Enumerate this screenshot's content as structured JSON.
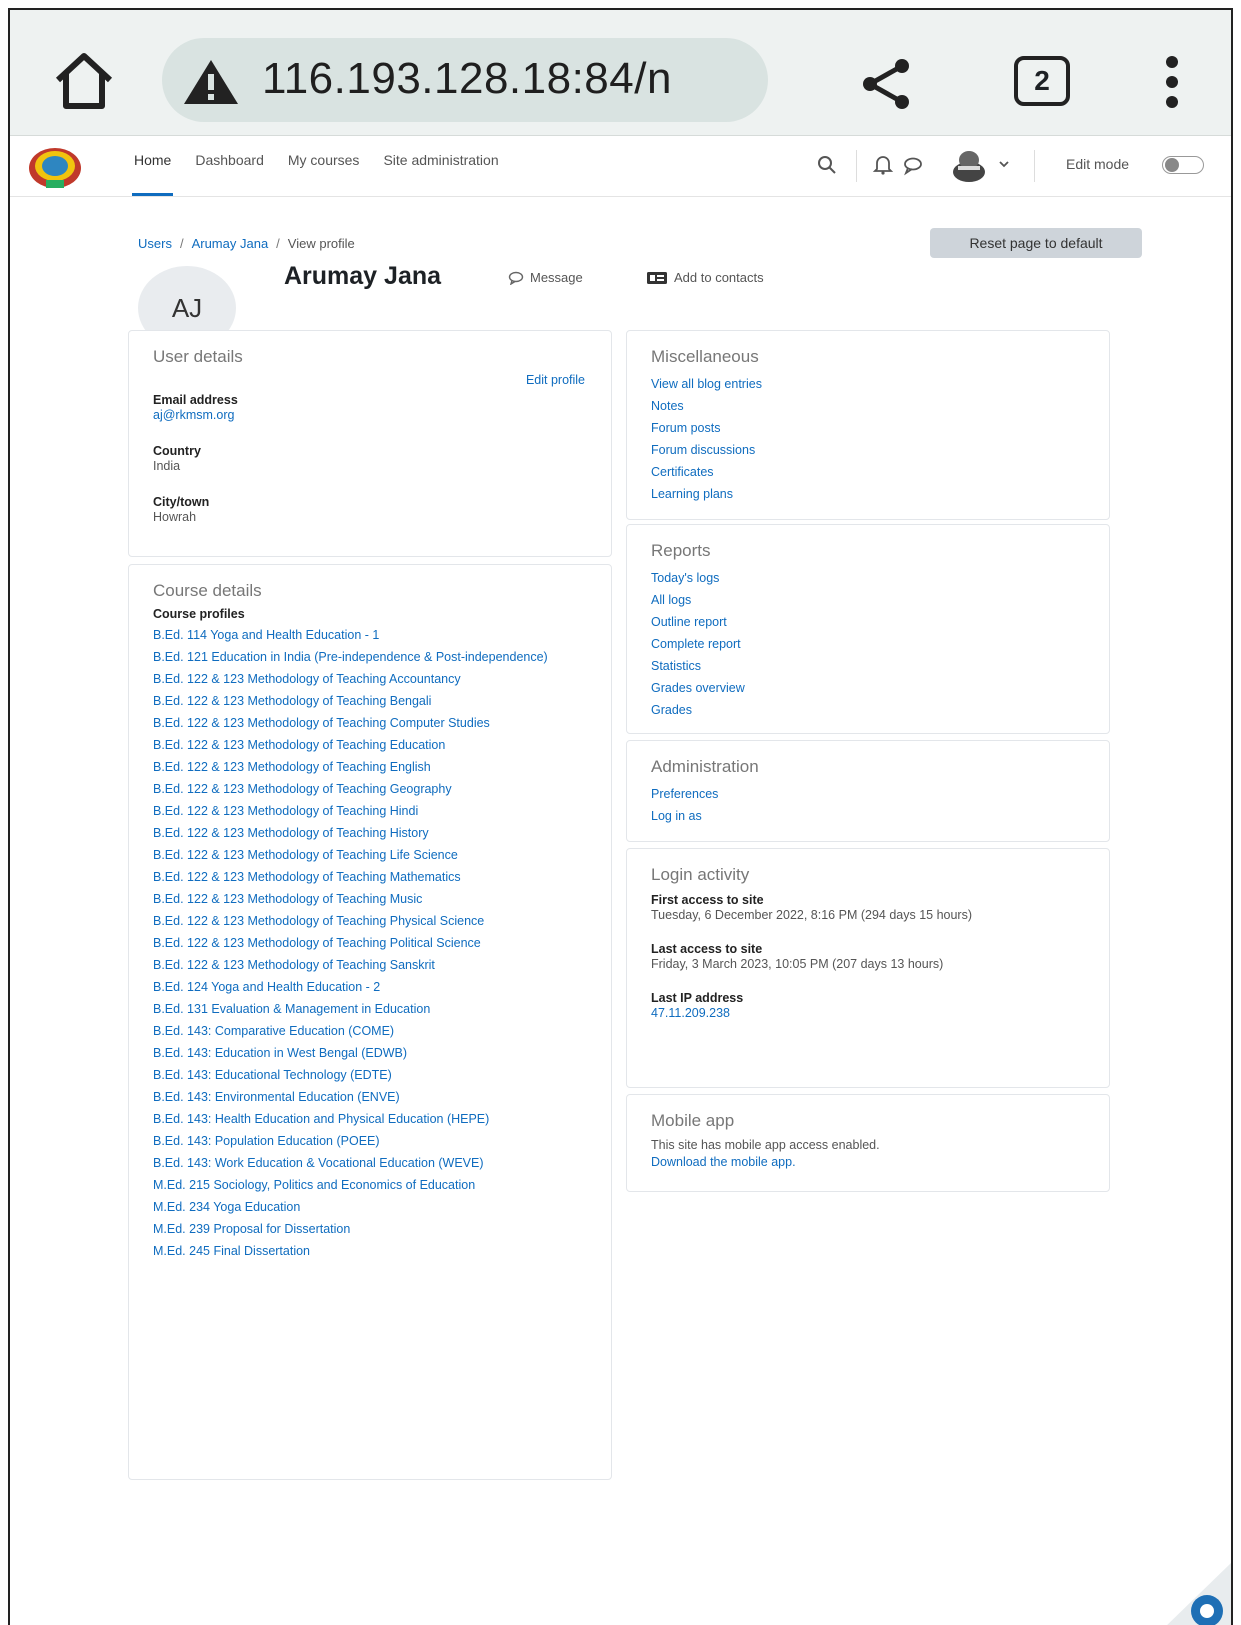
{
  "browser": {
    "url": "116.193.128.18:84/n",
    "tab_count": "2"
  },
  "nav": {
    "items": [
      {
        "label": "Home",
        "active": true
      },
      {
        "label": "Dashboard",
        "active": false
      },
      {
        "label": "My courses",
        "active": false
      },
      {
        "label": "Site administration",
        "active": false
      }
    ],
    "edit_mode_label": "Edit mode"
  },
  "breadcrumb": {
    "users": "Users",
    "user": "Arumay Jana",
    "current": "View profile",
    "sep": "/"
  },
  "header": {
    "reset_label": "Reset page to default",
    "initials": "AJ",
    "name": "Arumay Jana",
    "message_label": "Message",
    "contacts_label": "Add to contacts"
  },
  "user_details": {
    "title": "User details",
    "edit_label": "Edit profile",
    "email_label": "Email address",
    "email": "aj@rkmsm.org",
    "country_label": "Country",
    "country": "India",
    "city_label": "City/town",
    "city": "Howrah"
  },
  "course_details": {
    "title": "Course details",
    "profiles_label": "Course profiles",
    "courses": [
      "B.Ed. 114 Yoga and Health Education - 1",
      "B.Ed. 121 Education in India (Pre-independence & Post-independence)",
      "B.Ed. 122 & 123 Methodology of Teaching Accountancy",
      "B.Ed. 122 & 123 Methodology of Teaching Bengali",
      "B.Ed. 122 & 123 Methodology of Teaching Computer Studies",
      "B.Ed. 122 & 123 Methodology of Teaching Education",
      "B.Ed. 122 & 123 Methodology of Teaching English",
      "B.Ed. 122 & 123 Methodology of Teaching Geography",
      "B.Ed. 122 & 123 Methodology of Teaching Hindi",
      "B.Ed. 122 & 123 Methodology of Teaching History",
      "B.Ed. 122 & 123 Methodology of Teaching Life Science",
      "B.Ed. 122 & 123 Methodology of Teaching Mathematics",
      "B.Ed. 122 & 123 Methodology of Teaching Music",
      "B.Ed. 122 & 123 Methodology of Teaching Physical Science",
      "B.Ed. 122 & 123 Methodology of Teaching Political Science",
      "B.Ed. 122 & 123 Methodology of Teaching Sanskrit",
      "B.Ed. 124 Yoga and Health Education - 2",
      "B.Ed. 131 Evaluation & Management in Education",
      "B.Ed. 143: Comparative Education (COME)",
      "B.Ed. 143: Education in West Bengal (EDWB)",
      "B.Ed. 143: Educational Technology (EDTE)",
      "B.Ed. 143: Environmental Education (ENVE)",
      "B.Ed. 143: Health Education and Physical Education (HEPE)",
      "B.Ed. 143: Population Education (POEE)",
      "B.Ed. 143: Work Education & Vocational Education (WEVE)",
      "M.Ed. 215 Sociology, Politics and Economics of Education",
      "M.Ed. 234 Yoga Education",
      "M.Ed. 239 Proposal for Dissertation",
      "M.Ed. 245 Final Dissertation"
    ]
  },
  "miscellaneous": {
    "title": "Miscellaneous",
    "links": [
      "View all blog entries",
      "Notes",
      "Forum posts",
      "Forum discussions",
      "Certificates",
      "Learning plans"
    ]
  },
  "reports": {
    "title": "Reports",
    "links": [
      "Today's logs",
      "All logs",
      "Outline report",
      "Complete report",
      "Statistics",
      "Grades overview",
      "Grades"
    ]
  },
  "administration": {
    "title": "Administration",
    "links": [
      "Preferences",
      "Log in as"
    ]
  },
  "login_activity": {
    "title": "Login activity",
    "first_label": "First access to site",
    "first_value": "Tuesday, 6 December 2022, 8:16 PM  (294 days 15 hours)",
    "last_label": "Last access to site",
    "last_value": "Friday, 3 March 2023, 10:05 PM  (207 days 13 hours)",
    "ip_label": "Last IP address",
    "ip_value": "47.11.209.238"
  },
  "mobile_app": {
    "title": "Mobile app",
    "text": "This site has mobile app access enabled.",
    "link": "Download the mobile app."
  },
  "colors": {
    "link": "#0f6cbf",
    "browser_bar": "#eef2f1",
    "url_pill": "#d9e3e1"
  }
}
